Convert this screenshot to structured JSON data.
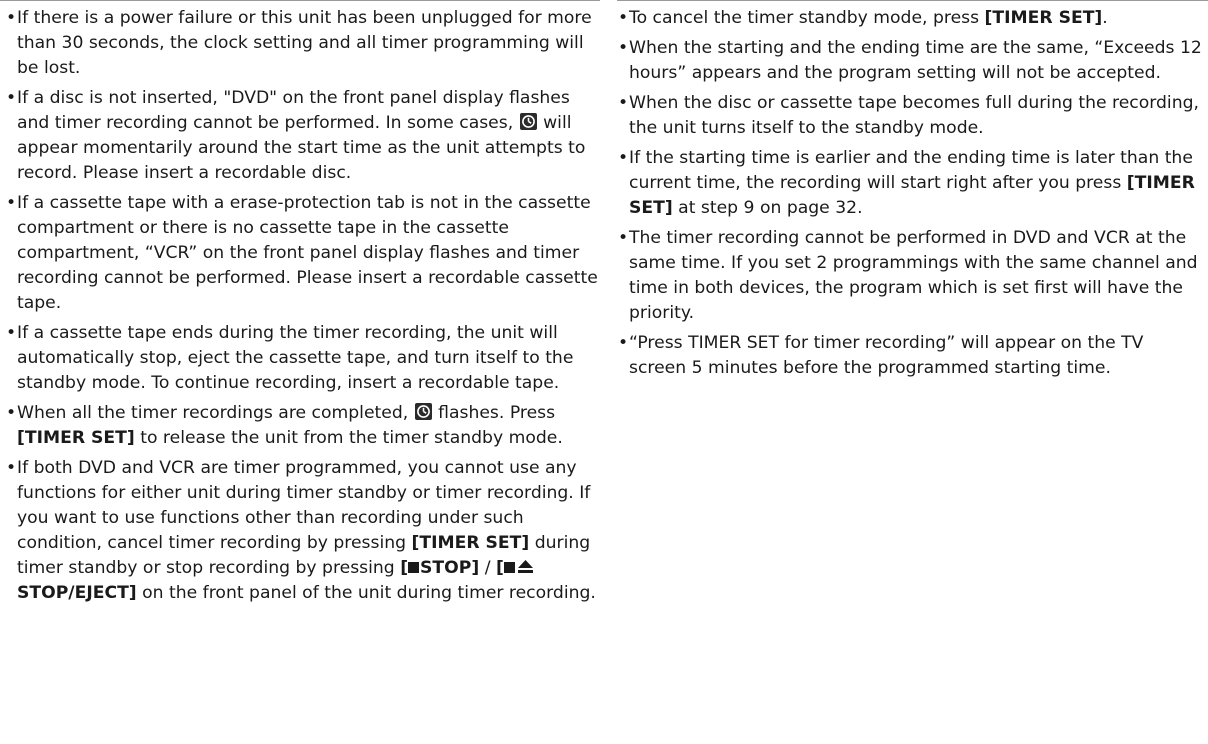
{
  "left_column": {
    "b1": "If there is a power failure or this unit has been unplugged for more than 30 seconds, the clock setting and all timer programming will be lost.",
    "b2_a": "If a disc is not inserted, \"DVD\" on the front panel display flashes and timer recording cannot be performed. In some cases,",
    "b2_b": "will appear momentarily around the start time as the unit attempts to record. Please insert a recordable disc.",
    "b3": "If a cassette tape with a erase-protection tab is not in the cassette compartment or there is no cassette tape in the cassette compartment, “VCR” on the front panel display flashes and timer recording cannot be performed. Please insert a recordable cassette tape.",
    "b4": "If a cassette tape ends during the timer recording, the unit will automatically stop, eject the cassette tape, and turn itself to the standby mode. To continue recording, insert a recordable tape.",
    "b5_a": "When all the timer recordings are completed,",
    "b5_b": "flashes. Press",
    "b5_key": "[TIMER SET]",
    "b5_c": "to release the unit from the timer standby mode.",
    "b6_a": "If both DVD and VCR are timer programmed, you cannot use any functions for either unit during timer standby or timer recording. If you want to use functions other than recording under such condition, cancel timer recording by pressing",
    "b6_key1": "[TIMER SET]",
    "b6_b": "during timer standby or stop recording by pressing",
    "b6_key2_open": "[",
    "b6_key2_label": "STOP]",
    "b6_sep": "/",
    "b6_key3_open": "[",
    "b6_key3_label": "STOP/EJECT]",
    "b6_c": "on the front panel of the unit during timer recording."
  },
  "right_column": {
    "b1_a": "To cancel the timer standby mode, press",
    "b1_key": "[TIMER SET]",
    "b1_end": ".",
    "b2": "When the starting and the ending time are the same, “Exceeds 12 hours” appears and the program setting will not be accepted.",
    "b3": "When the disc or cassette tape becomes full during the recording, the unit turns itself to the standby mode.",
    "b4_a": "If the starting time is earlier and the ending time is later than the current time, the recording will start right after you press",
    "b4_key": "[TIMER SET]",
    "b4_b": "at step 9 on page 32.",
    "b5": "The timer recording cannot be performed in DVD and VCR at the same time. If you set 2 programmings with the same channel and time in both devices, the program which is set first will have the priority.",
    "b6": "“Press TIMER SET for timer recording” will appear on the TV screen 5 minutes before the programmed starting time."
  },
  "icons": {
    "timer": "timer-clock-icon",
    "stop": "stop-square-icon",
    "eject": "eject-icon"
  }
}
